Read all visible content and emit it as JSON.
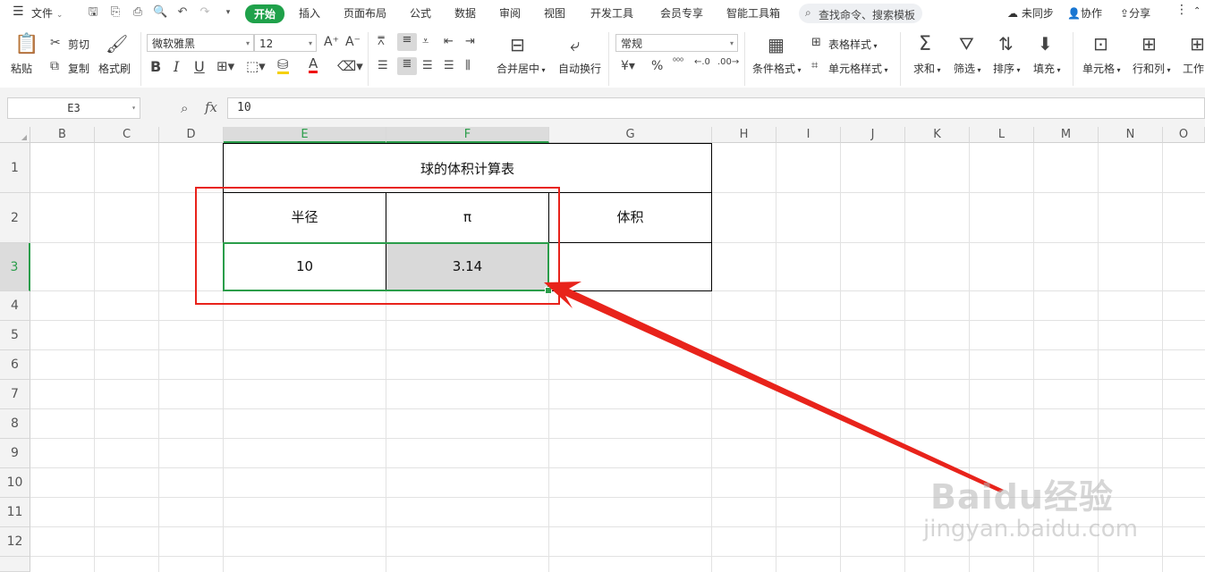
{
  "menubar": {
    "file_label": "文件",
    "tabs": [
      "开始",
      "插入",
      "页面布局",
      "公式",
      "数据",
      "审阅",
      "视图",
      "开发工具",
      "会员专享",
      "智能工具箱"
    ],
    "search_placeholder": "查找命令、搜索模板",
    "sync_label": "未同步",
    "collab_label": "协作",
    "share_label": "分享"
  },
  "ribbon": {
    "paste": "粘贴",
    "cut": "剪切",
    "copy": "复制",
    "format_painter": "格式刷",
    "font_name": "微软雅黑",
    "font_size": "12",
    "merge_center": "合并居中",
    "wrap_text": "自动换行",
    "number_format": "常规",
    "table_style": "表格样式",
    "cond_format": "条件格式",
    "cell_style": "单元格样式",
    "sum": "求和",
    "filter": "筛选",
    "sort": "排序",
    "fill": "填充",
    "cell": "单元格",
    "row_col": "行和列",
    "worksheet": "工作"
  },
  "formula_bar": {
    "cell_ref": "E3",
    "fx": "fx",
    "value": "10"
  },
  "columns": [
    "B",
    "C",
    "D",
    "E",
    "F",
    "G",
    "H",
    "I",
    "J",
    "K",
    "L",
    "M",
    "N",
    "O"
  ],
  "rows": [
    "1",
    "2",
    "3",
    "4",
    "5",
    "6",
    "7",
    "8",
    "9",
    "10",
    "11",
    "12"
  ],
  "sheet": {
    "title": "球的体积计算表",
    "header_radius": "半径",
    "header_pi": "π",
    "header_volume": "体积",
    "radius_value": "10",
    "pi_value": "3.14",
    "volume_value": ""
  },
  "watermark": {
    "brand": "Baidu经验",
    "url": "jingyan.baidu.com"
  },
  "colors": {
    "accent": "#1fa14a",
    "annotation": "#e8231b",
    "selection": "#2a9d4a"
  }
}
